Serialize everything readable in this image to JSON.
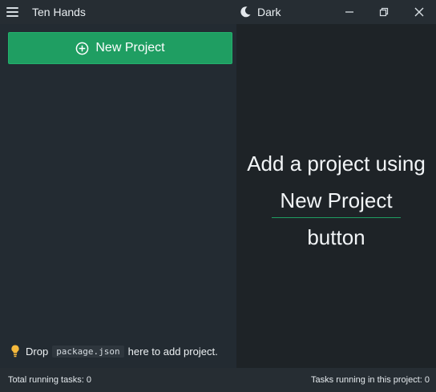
{
  "titlebar": {
    "app_title": "Ten Hands",
    "theme_label": "Dark",
    "icons": {
      "menu": "hamburger-menu-icon",
      "theme": "moon-icon",
      "minimize": "minimize-icon",
      "maximize": "restore-icon",
      "close": "close-icon"
    }
  },
  "sidebar": {
    "new_project_label": "New Project",
    "new_project_icon": "plus-circle-icon",
    "drop_hint": {
      "prefix": "Drop",
      "code": "package.json",
      "suffix": "here to add project.",
      "icon": "lightbulb-icon"
    }
  },
  "main": {
    "empty_line1": "Add a project using",
    "empty_line2": "New Project",
    "empty_line3": "button"
  },
  "statusbar": {
    "total_running": "Total running tasks: 0",
    "project_running": "Tasks running in this project: 0"
  },
  "colors": {
    "accent": "#1f9e62",
    "sidebar_bg": "#232b32",
    "main_bg": "#1e2327",
    "bar_bg": "#262d33",
    "bulb": "#f5b93c"
  }
}
